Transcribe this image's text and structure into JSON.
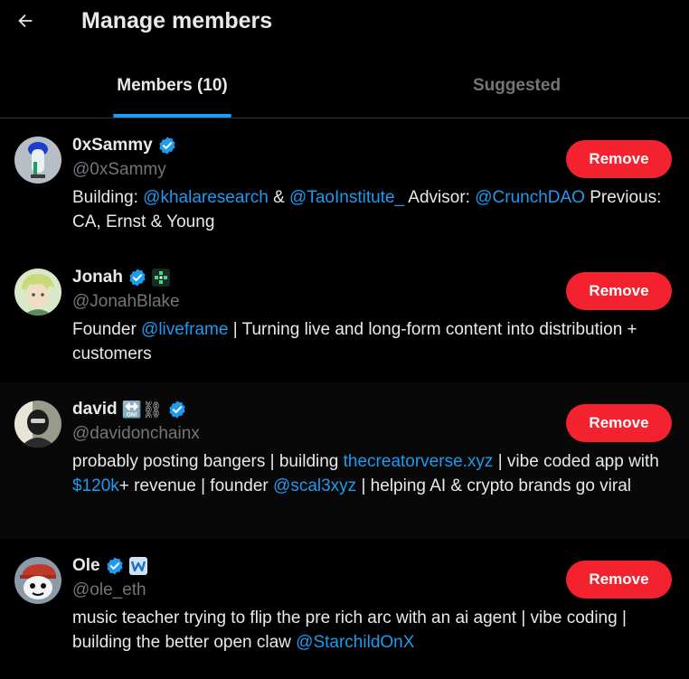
{
  "header": {
    "title": "Manage members",
    "back_icon": "arrow-left-icon"
  },
  "tabs": [
    {
      "label": "Members (10)",
      "active": true
    },
    {
      "label": "Suggested",
      "active": false
    }
  ],
  "colors": {
    "accent": "#1d9bf0",
    "remove": "#f4212e",
    "muted": "#71767b",
    "text": "#e7e9ea"
  },
  "members": [
    {
      "name": "0xSammy",
      "handle": "@0xSammy",
      "verified": true,
      "remove_label": "Remove",
      "bio": {
        "p1": "Building: ",
        "l1": "@khalaresearch",
        "p2": " & ",
        "l2": "@TaoInstitute_",
        "p3": " Advisor: ",
        "l3": "@CrunchDAO",
        "p4": " Previous: CA, Ernst & Young"
      }
    },
    {
      "name": "Jonah",
      "handle": "@JonahBlake",
      "verified": true,
      "remove_label": "Remove",
      "bio": {
        "p1": "Founder ",
        "l1": "@liveframe",
        "p2": " | Turning live and long-form content into distribution + customers"
      }
    },
    {
      "name": "david",
      "name_emoji": "🔛⛓",
      "handle": "@davidonchainx",
      "verified": true,
      "remove_label": "Remove",
      "bio": {
        "p1": "probably posting bangers | building ",
        "l1": "thecreatorverse.xyz",
        "p2": " | vibe coded app with ",
        "l2": "$120k",
        "p3": "+ revenue | founder ",
        "l3": "@scal3xyz",
        "p4": " | helping AI & crypto brands go viral"
      }
    },
    {
      "name": "Ole",
      "handle": "@ole_eth",
      "verified": true,
      "remove_label": "Remove",
      "bio": {
        "p1": "music teacher trying to flip the pre rich arc with an ai agent | vibe coding | building the better open claw ",
        "l1": "@StarchildOnX"
      }
    }
  ]
}
